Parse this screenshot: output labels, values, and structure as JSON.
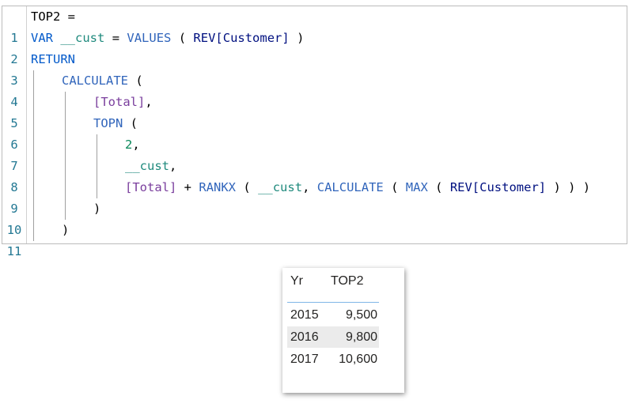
{
  "editor": {
    "lines": [
      {
        "n": "1"
      },
      {
        "n": "2"
      },
      {
        "n": "3"
      },
      {
        "n": "4"
      },
      {
        "n": "5"
      },
      {
        "n": "6"
      },
      {
        "n": "7"
      },
      {
        "n": "8"
      },
      {
        "n": "9"
      },
      {
        "n": "10"
      },
      {
        "n": "11"
      }
    ],
    "tokens": {
      "l1": "TOP2 =",
      "l2_var": "VAR",
      "l2_name": "__cust",
      "l2_eq": "=",
      "l2_fn": "VALUES",
      "l2_open": "(",
      "l2_col": "REV[Customer]",
      "l2_close": ")",
      "l3": "RETURN",
      "l4_fn": "CALCULATE",
      "l4_open": "(",
      "l5_meas": "[Total]",
      "l5_comma": ",",
      "l6_fn": "TOPN",
      "l6_open": "(",
      "l7_num": "2",
      "l7_comma": ",",
      "l8_var": "__cust",
      "l8_comma": ",",
      "l9_meas": "[Total]",
      "l9_plus": "+",
      "l9_rankx": "RANKX",
      "l9_p1": "(",
      "l9_var": "__cust",
      "l9_comma": ",",
      "l9_calc": "CALCULATE",
      "l9_p2": "(",
      "l9_max": "MAX",
      "l9_p3": "(",
      "l9_col": "REV[Customer]",
      "l9_close": ") ) )",
      "l10": ")",
      "l11": ")"
    }
  },
  "table": {
    "headers": [
      "Yr",
      "TOP2"
    ],
    "rows": [
      {
        "yr": "2015",
        "val": "9,500"
      },
      {
        "yr": "2016",
        "val": "9,800"
      },
      {
        "yr": "2017",
        "val": "10,600"
      }
    ]
  }
}
